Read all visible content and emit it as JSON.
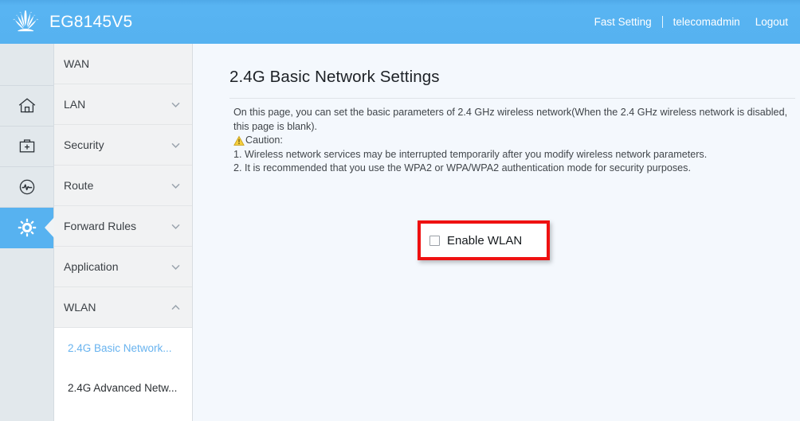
{
  "header": {
    "brand_name": "EG8145V5",
    "logo_icon": "huawei-flower-logo",
    "links": [
      {
        "label": "Fast Setting",
        "name": "fast-setting-link"
      },
      {
        "label": "telecomadmin",
        "name": "current-user-link"
      },
      {
        "label": "Logout",
        "name": "logout-link"
      }
    ]
  },
  "icon_rail": {
    "items": [
      {
        "icon": "home-icon",
        "name": "rail-item-home",
        "active": false
      },
      {
        "icon": "first-aid-kit-icon",
        "name": "rail-item-maintenance",
        "active": false
      },
      {
        "icon": "gauge-pulse-icon",
        "name": "rail-item-status",
        "active": false
      },
      {
        "icon": "gear-icon",
        "name": "rail-item-advanced",
        "active": true
      }
    ]
  },
  "menu": {
    "items": [
      {
        "label": "WAN",
        "expandable": false,
        "expanded": false
      },
      {
        "label": "LAN",
        "expandable": true,
        "expanded": false
      },
      {
        "label": "Security",
        "expandable": true,
        "expanded": false
      },
      {
        "label": "Route",
        "expandable": true,
        "expanded": false
      },
      {
        "label": "Forward Rules",
        "expandable": true,
        "expanded": false
      },
      {
        "label": "Application",
        "expandable": true,
        "expanded": false
      },
      {
        "label": "WLAN",
        "expandable": true,
        "expanded": true
      }
    ],
    "submenu": [
      {
        "label": "2.4G Basic Network...",
        "selected": true
      },
      {
        "label": "2.4G Advanced Netw...",
        "selected": false
      }
    ]
  },
  "main": {
    "title": "2.4G Basic Network Settings",
    "description_line1": "On this page, you can set the basic parameters of 2.4 GHz wireless network(When the 2.4 GHz wireless network is disabled, this page is blank).",
    "caution_label": "Caution:",
    "caution_icon": "warning-triangle-icon",
    "caution_items": [
      "1. Wireless network services may be interrupted temporarily after you modify wireless network parameters.",
      "2. It is recommended that you use the WPA2 or WPA/WPA2 authentication mode for security purposes."
    ],
    "enable_wlan": {
      "label": "Enable WLAN",
      "checked": false
    }
  },
  "colors": {
    "header_blue": "#56b2f0",
    "accent_blue": "#68b3ef",
    "annotation_red": "#ef1111",
    "page_bg": "#f4f8fd",
    "rail_bg": "#e2e8ec",
    "menu_item_bg": "#f1f2f3",
    "caution_yellow": "#f2c12b"
  }
}
